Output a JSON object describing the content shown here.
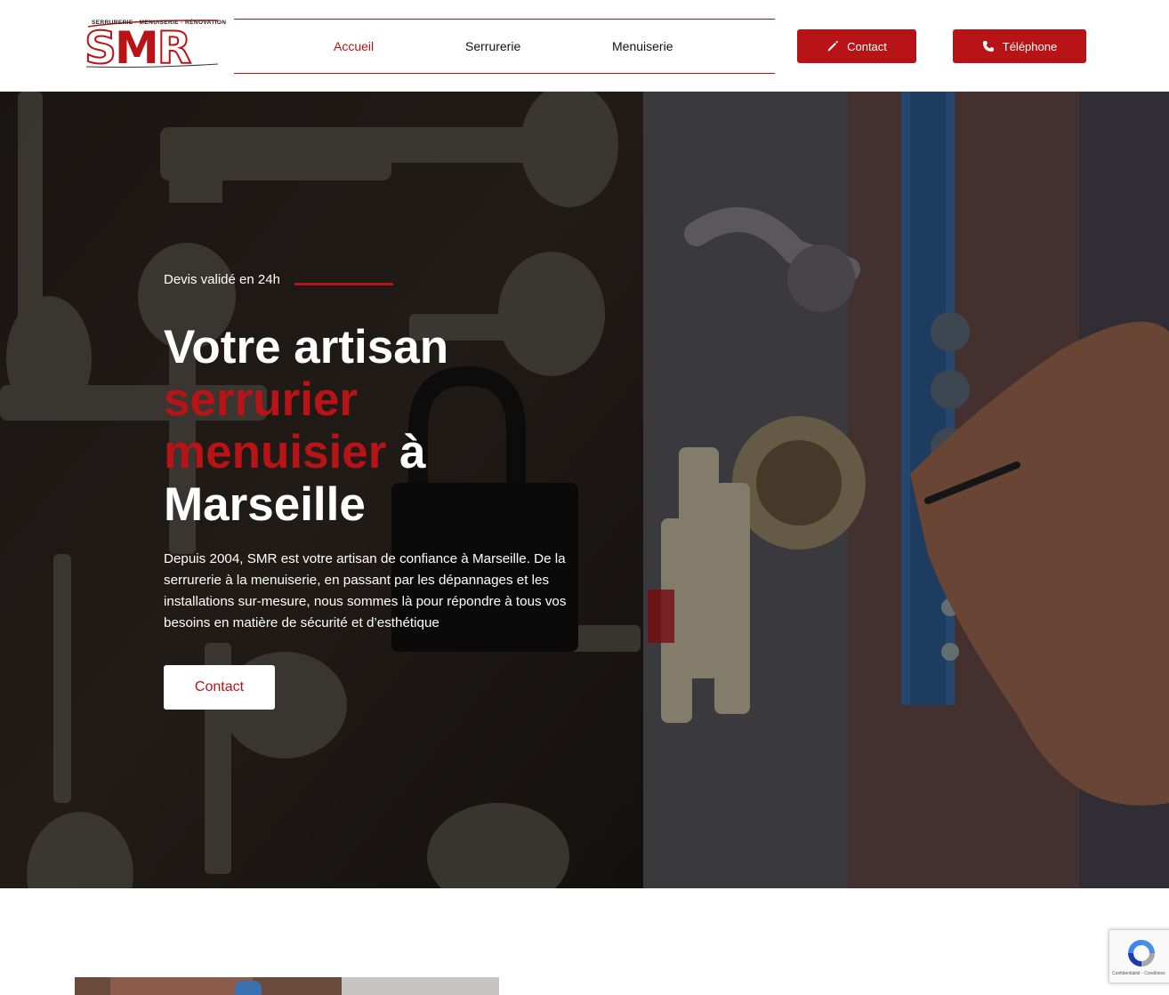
{
  "header": {
    "logo": {
      "tagline": "SERRURERIE - MENUISERIE - RÉNOVATION",
      "letters": [
        "S",
        "M",
        "R"
      ]
    },
    "nav": [
      {
        "label": "Accueil",
        "active": true
      },
      {
        "label": "Serrurerie",
        "active": false
      },
      {
        "label": "Menuiserie",
        "active": false
      }
    ],
    "buttons": {
      "contact": {
        "label": "Contact",
        "icon": "pencil-icon"
      },
      "phone": {
        "label": "Téléphone",
        "icon": "phone-icon"
      }
    }
  },
  "hero": {
    "eyebrow": "Devis validé en 24h",
    "title": {
      "line1": "Votre artisan",
      "accent1": "serrurier",
      "accent2": "menuisier",
      "tail": " à",
      "line4": "Marseille"
    },
    "description": "Depuis 2004, SMR est votre artisan de confiance à Marseille. De la serrurerie à la menuiserie, en passant par les dépannages et les installations sur-mesure, nous sommes là pour répondre à tous vos besoins en matière de sécurité et d’esthétique",
    "cta_label": "Contact"
  },
  "recaptcha": {
    "text": "Confidentialité - Conditions"
  },
  "colors": {
    "brand": "#b81316",
    "white": "#ffffff",
    "text": "#111111"
  }
}
